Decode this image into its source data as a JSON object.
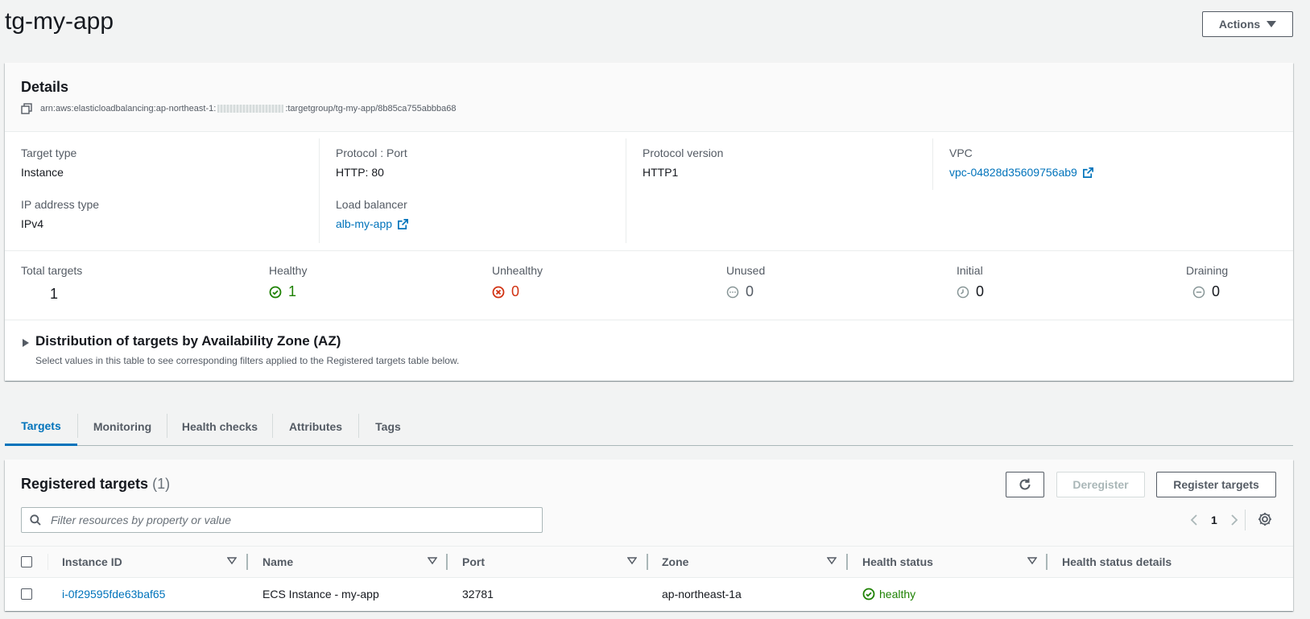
{
  "page": {
    "title": "tg-my-app",
    "actions_label": "Actions"
  },
  "details": {
    "title": "Details",
    "arn_prefix": "arn:aws:elasticloadbalancing:ap-northeast-1:",
    "arn_suffix": ":targetgroup/tg-my-app/8b85ca755abbba68",
    "fields": {
      "target_type": {
        "label": "Target type",
        "value": "Instance"
      },
      "ip_address_type": {
        "label": "IP address type",
        "value": "IPv4"
      },
      "protocol_port": {
        "label": "Protocol : Port",
        "value": "HTTP: 80"
      },
      "load_balancer": {
        "label": "Load balancer",
        "value": "alb-my-app"
      },
      "protocol_version": {
        "label": "Protocol version",
        "value": "HTTP1"
      },
      "vpc": {
        "label": "VPC",
        "value": "vpc-04828d35609756ab9"
      }
    },
    "stats": {
      "total": {
        "label": "Total targets",
        "value": "1"
      },
      "healthy": {
        "label": "Healthy",
        "value": "1",
        "color": "#1d8102"
      },
      "unhealthy": {
        "label": "Unhealthy",
        "value": "0",
        "color": "#d13212"
      },
      "unused": {
        "label": "Unused",
        "value": "0",
        "color": "#687078"
      },
      "initial": {
        "label": "Initial",
        "value": "0",
        "color": "#687078"
      },
      "draining": {
        "label": "Draining",
        "value": "0",
        "color": "#687078"
      }
    },
    "az": {
      "title": "Distribution of targets by Availability Zone (AZ)",
      "description": "Select values in this table to see corresponding filters applied to the Registered targets table below."
    }
  },
  "tabs": [
    {
      "label": "Targets",
      "active": true
    },
    {
      "label": "Monitoring"
    },
    {
      "label": "Health checks"
    },
    {
      "label": "Attributes"
    },
    {
      "label": "Tags"
    }
  ],
  "targets": {
    "title": "Registered targets",
    "count": "(1)",
    "deregister_label": "Deregister",
    "register_label": "Register targets",
    "search_placeholder": "Filter resources by property or value",
    "page_number": "1",
    "columns": [
      "Instance ID",
      "Name",
      "Port",
      "Zone",
      "Health status",
      "Health status details"
    ],
    "rows": [
      {
        "instance_id": "i-0f29595fde63baf65",
        "name": "ECS Instance - my-app",
        "port": "32781",
        "zone": "ap-northeast-1a",
        "health_status": "healthy",
        "health_status_details": ""
      }
    ]
  },
  "colors": {
    "link": "#0073bb",
    "healthy": "#1d8102",
    "unhealthy": "#d13212",
    "neutral": "#687078"
  }
}
